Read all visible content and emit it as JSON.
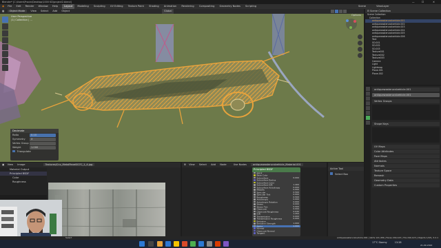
{
  "window": {
    "title": "Blender* [C:\\Users\\Pravin\\Desktop\\1000 KD\\project2.blend]",
    "controls": [
      "—",
      "☐",
      "✕"
    ]
  },
  "menubar": {
    "items": [
      "File",
      "Edit",
      "Render",
      "Window",
      "Help"
    ],
    "workspaces": [
      "Layout",
      "Modeling",
      "Sculpting",
      "UV Editing",
      "Texture Paint",
      "Shading",
      "Animation",
      "Rendering",
      "Compositing",
      "Geometry Nodes",
      "Scripting"
    ],
    "active_workspace": "Layout",
    "scene": "Scene",
    "view_layer": "ViewLayer"
  },
  "viewport": {
    "mode": "Object Mode",
    "menus": [
      "View",
      "Select",
      "Add",
      "Object"
    ],
    "transform": "Global",
    "info_line1": "User Perspective",
    "info_line2": "(1) Collection | ...",
    "options_label": "Options",
    "colors": {
      "background": "#6d7a4a",
      "mesh_orange": "#e8a33c",
      "mesh_green": "#b6b98a"
    }
  },
  "operator_panel": {
    "title": "Decimate",
    "fields": [
      {
        "label": "Ratio",
        "value": "0.10"
      },
      {
        "label": "Symmetry",
        "value": "X"
      },
      {
        "label": "Vertex Group",
        "value": ""
      },
      {
        "label": "Weight",
        "value": "1.000"
      }
    ],
    "checkbox_label": "Triangulate"
  },
  "outliner": {
    "title": "Scene Collection",
    "items": [
      "Scene Collection",
      "Collection",
      "antiquewasteruralvehicle.001",
      "antiquewasteruralvehicle.002",
      "antiquewasteruralvehicle.003",
      "antiquewasteruralvehicle.004",
      "antiquewasteruralvehicle.005",
      "antiquewasteruralvehicle.006",
      "Text",
      "SO.001",
      "SO.002",
      "SO.003",
      "Texture001",
      "Texture002",
      "Texture003",
      "Camera",
      "Light",
      "Lightmap",
      "Plane.001",
      "Plane.002"
    ],
    "selected_index": 2
  },
  "properties": {
    "object_name": "antiquewasteruralvehicle.001",
    "data_name": "antiquewasteruralvehicle.001",
    "sections": [
      "Vertex Groups",
      "Shape Keys",
      "UV Maps",
      "Color Attributes",
      "Face Maps",
      "Attributes",
      "Normals",
      "Texture Space",
      "Remesh",
      "Geometry Data",
      "Custom Properties"
    ],
    "expanded": [
      "Vertex Groups",
      "Shape Keys"
    ]
  },
  "image_editor": {
    "menus": [
      "View",
      "Image"
    ],
    "image_name": "Textures/Cnc_MetalPanel007C_1_4.jpg"
  },
  "file_panel": {
    "items": [
      "Material Output",
      "Principled BSDF",
      "Color",
      "Roughness"
    ]
  },
  "node_editor": {
    "menus": [
      "View",
      "Select",
      "Add",
      "Node"
    ],
    "use_nodes": "Use Nodes",
    "material": "antiquewasteruralvehicle_Material.001",
    "node_title": "Principled BSDF",
    "rows": [
      {
        "label": "BSDF",
        "socket": "gray",
        "value": ""
      },
      {
        "label": "Base Color",
        "socket": "yellow",
        "value": ""
      },
      {
        "label": "Subsurface",
        "socket": "gray",
        "value": "0.000"
      },
      {
        "label": "Subsurface Radius",
        "socket": "purple",
        "value": ""
      },
      {
        "label": "Subsurface Color",
        "socket": "yellow",
        "value": ""
      },
      {
        "label": "Subsurface IOR",
        "socket": "gray",
        "value": "1.400"
      },
      {
        "label": "Subsurface Anisotropy",
        "socket": "gray",
        "value": "0.000"
      },
      {
        "label": "Metallic",
        "socket": "gray",
        "value": "0.000"
      },
      {
        "label": "Specular",
        "socket": "gray",
        "value": "0.500"
      },
      {
        "label": "Specular Tint",
        "socket": "gray",
        "value": "0.000"
      },
      {
        "label": "Roughness",
        "socket": "gray",
        "value": "0.500"
      },
      {
        "label": "Anisotropic",
        "socket": "gray",
        "value": "0.000"
      },
      {
        "label": "Anisotropic Rotation",
        "socket": "gray",
        "value": "0.000"
      },
      {
        "label": "Sheen",
        "socket": "gray",
        "value": "0.000"
      },
      {
        "label": "Sheen Tint",
        "socket": "gray",
        "value": "0.500"
      },
      {
        "label": "Clearcoat",
        "socket": "gray",
        "value": "0.000"
      },
      {
        "label": "Clearcoat Roughness",
        "socket": "gray",
        "value": "0.030"
      },
      {
        "label": "IOR",
        "socket": "gray",
        "value": "1.450"
      },
      {
        "label": "Transmission",
        "socket": "gray",
        "value": "0.000"
      },
      {
        "label": "Transmission Roughness",
        "socket": "gray",
        "value": "0.000"
      },
      {
        "label": "Emission",
        "socket": "yellow",
        "value": ""
      },
      {
        "label": "Emission Strength",
        "socket": "gray",
        "value": "1.000"
      },
      {
        "label": "Alpha",
        "socket": "gray",
        "value": "1.000"
      },
      {
        "label": "Normal",
        "socket": "purple",
        "value": ""
      },
      {
        "label": "Clearcoat Normal",
        "socket": "purple",
        "value": ""
      },
      {
        "label": "Tangent",
        "socket": "purple",
        "value": ""
      }
    ],
    "selected_row": 22
  },
  "sidebar_panel": {
    "title": "Active Tool",
    "tool": "Select Box"
  },
  "statusbar": {
    "left": "Select",
    "right": "antiquewasteruralvehicle.001 | Verts 121,456 | Faces 240,123 | Tris 240,123 | Objects 1/18 | 3.2.1"
  },
  "taskbar": {
    "weather": "17°C Stormy",
    "time": "13:28",
    "date": "21-09-2022",
    "colors": [
      "#e8a33c",
      "#2c78d4",
      "#f5c400",
      "#d84a2a",
      "#4caf50",
      "#2c78d4",
      "#888888",
      "#d83b01",
      "#7d56c2"
    ]
  }
}
